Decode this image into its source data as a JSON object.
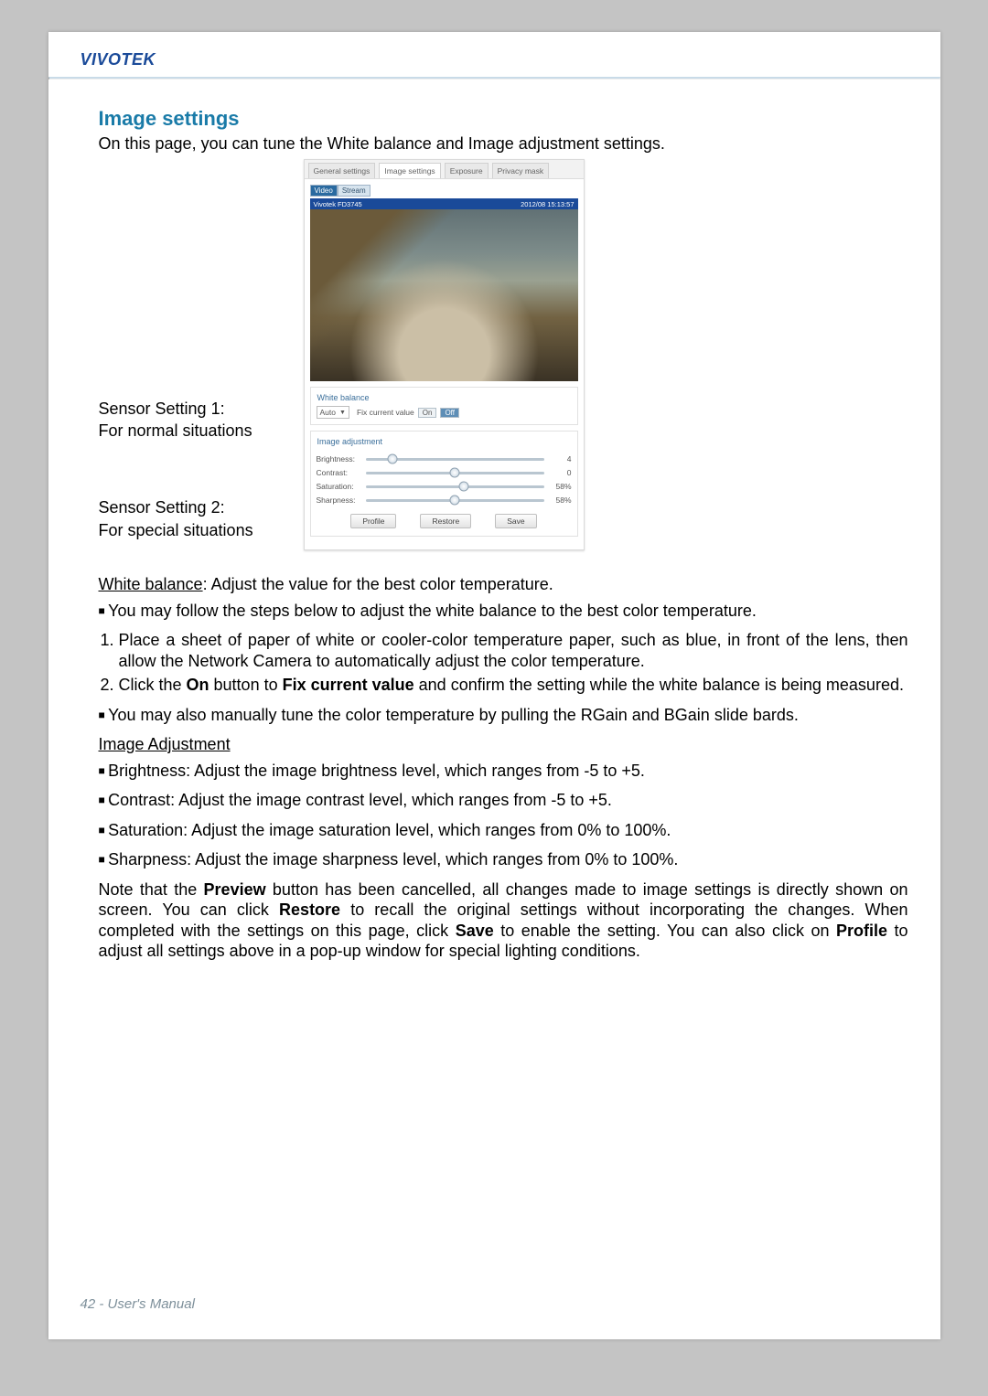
{
  "header": {
    "brand": "VIVOTEK"
  },
  "section": {
    "title": "Image settings",
    "intro": "On this page, you can tune the White balance and Image adjustment settings."
  },
  "figure": {
    "callouts": [
      {
        "line1": "Sensor Setting 1:",
        "line2": "For normal situations"
      },
      {
        "line1": "Sensor Setting 2:",
        "line2": "For special situations"
      }
    ],
    "panel": {
      "tabs": [
        "General settings",
        "Image settings",
        "Exposure",
        "Privacy mask"
      ],
      "active_tab_index": 1,
      "chips": {
        "left": "Video",
        "right": "Stream"
      },
      "preview_top_left": "Vivotek FD3745",
      "preview_top_right": "2012/08 15:13:57",
      "white_balance": {
        "title": "White balance",
        "select_label": "Auto",
        "fix_label": "Fix current value",
        "on": "On",
        "off": "Off"
      },
      "image_adjust": {
        "title": "Image adjustment",
        "rows": [
          {
            "label": "Brightness:",
            "value": "4",
            "pos": 15
          },
          {
            "label": "Contrast:",
            "value": "0",
            "pos": 50
          },
          {
            "label": "Saturation:",
            "value": "58%",
            "pos": 55
          },
          {
            "label": "Sharpness:",
            "value": "58%",
            "pos": 50
          }
        ]
      },
      "buttons": {
        "profile": "Profile",
        "restore": "Restore",
        "save": "Save"
      }
    }
  },
  "wb": {
    "heading": "White balance",
    "tail": ": Adjust the value for the best color temperature.",
    "bullet1": "You may follow the steps below to adjust the white balance to the best color temperature.",
    "step1": "Place a sheet of paper of white or cooler-color temperature paper, such as blue, in front of the lens, then allow the Network Camera to automatically adjust the color temperature.",
    "step2_a": "Click the ",
    "step2_b": "On",
    "step2_c": " button to ",
    "step2_d": "Fix current value",
    "step2_e": " and confirm the setting while the white balance is being measured.",
    "bullet2": "You may also manually tune the color temperature by pulling the RGain and BGain slide bards."
  },
  "adj": {
    "heading": "Image Adjustment",
    "brightness": "Brightness: Adjust the image brightness level, which ranges from -5 to +5.",
    "contrast": "Contrast: Adjust the image contrast level, which ranges from -5 to +5.",
    "saturation": "Saturation: Adjust the image saturation level, which ranges from 0% to 100%.",
    "sharpness": "Sharpness: Adjust the image sharpness level, which ranges from 0% to 100%."
  },
  "note": {
    "a": "Note that the ",
    "b": "Preview",
    "c": " button has been cancelled, all changes made to image settings is directly shown on screen. You can click ",
    "d": "Restore",
    "e": " to recall the original settings without incorporating the changes. When completed with the settings on this page, click ",
    "f": "Save",
    "g": " to enable the setting. You can also click on ",
    "h": "Profile",
    "i": " to adjust all settings above in a pop-up window for special lighting conditions."
  },
  "footer": {
    "page": "42 - User's Manual"
  }
}
